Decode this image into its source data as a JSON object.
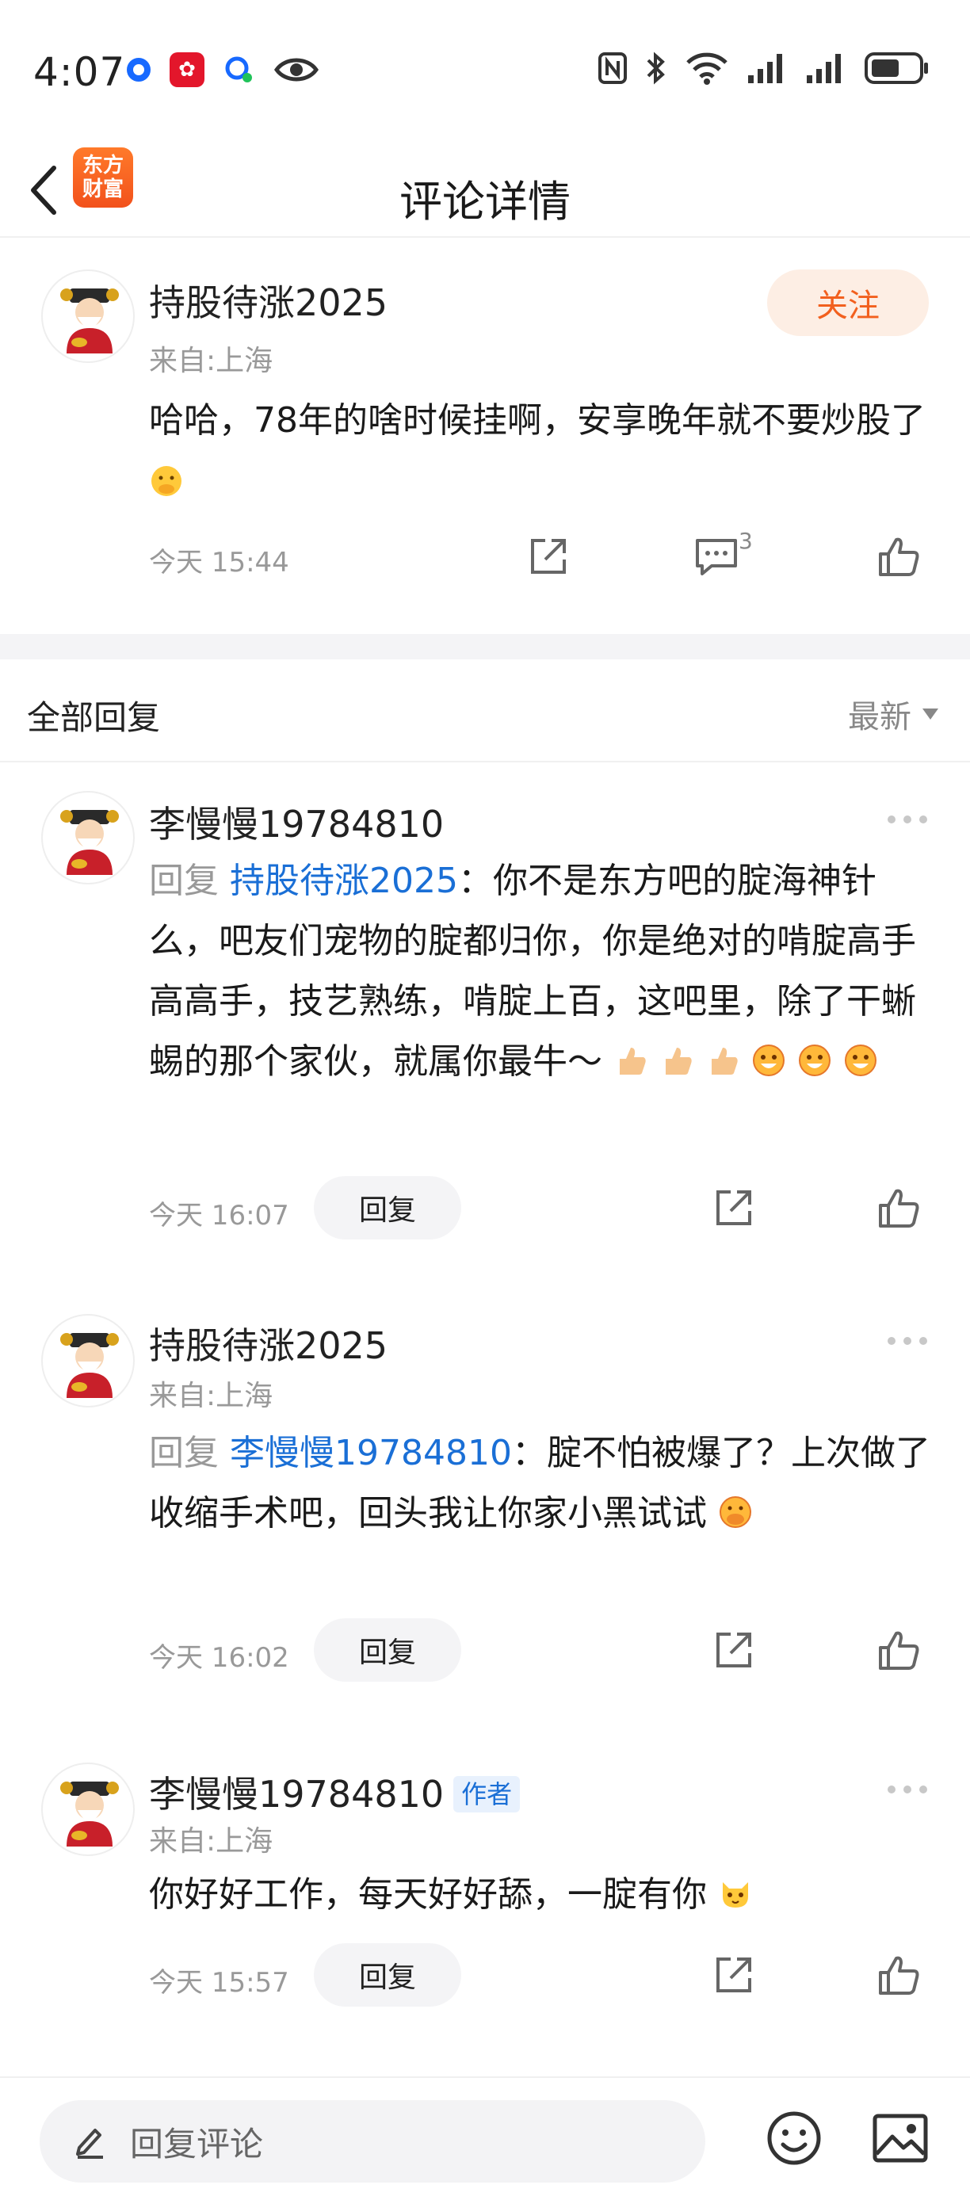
{
  "status_bar": {
    "time": "4:07"
  },
  "header": {
    "title": "评论详情",
    "logo_text_line1": "东方",
    "logo_text_line2": "财富"
  },
  "main_comment": {
    "username": "持股待涨2025",
    "location": "来自:上海",
    "follow_label": "关注",
    "content": "哈哈，78年的啥时候挂啊，安享晚年就不要炒股了",
    "time": "今天 15:44",
    "comment_count": "3"
  },
  "replies_section": {
    "title": "全部回复",
    "sort_label": "最新"
  },
  "replies": [
    {
      "username": "李慢慢19784810",
      "reply_prefix": "回复",
      "mention": "持股待涨2025",
      "content": "：你不是东方吧的腚海神针么，吧友们宠物的腚都归你，你是绝对的啃腚高手高高手，技艺熟练，啃腚上百，这吧里，除了干蜥蜴的那个家伙，就属你最牛～",
      "time": "今天 16:07",
      "reply_label": "回复"
    },
    {
      "username": "持股待涨2025",
      "location": "来自:上海",
      "reply_prefix": "回复",
      "mention": "李慢慢19784810",
      "content": "：腚不怕被爆了？上次做了收缩手术吧，回头我让你家小黑试试",
      "time": "今天 16:02",
      "reply_label": "回复"
    },
    {
      "username": "李慢慢19784810",
      "author_tag": "作者",
      "location": "来自:上海",
      "content": "你好好工作，每天好好舔，一腚有你",
      "time": "今天 15:57",
      "reply_label": "回复"
    }
  ],
  "bottom_bar": {
    "input_placeholder": "回复评论"
  },
  "colors": {
    "accent_orange": "#f2601e",
    "link_blue": "#1a6fd6",
    "muted_gray": "#999999"
  }
}
